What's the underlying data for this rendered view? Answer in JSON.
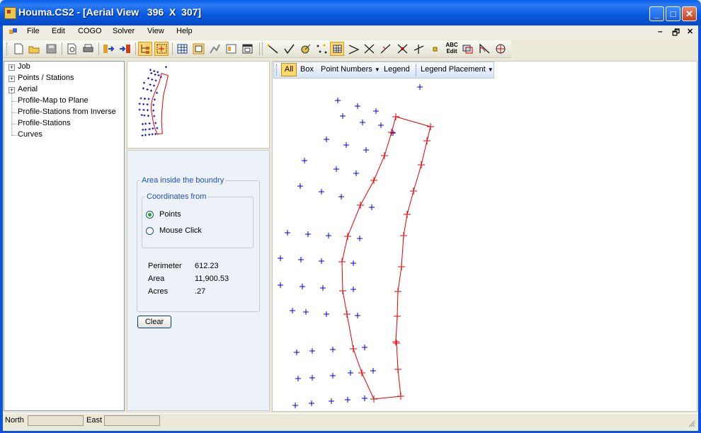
{
  "window": {
    "title": "Houma.CS2 - [Aerial View   396  X  307]",
    "minimize": "_",
    "maximize": "□",
    "close": "✕"
  },
  "menu": [
    "File",
    "Edit",
    "COGO",
    "Solver",
    "View",
    "Help"
  ],
  "mdi_controls": {
    "minimize": "–",
    "restore": "🗗",
    "close": "✕"
  },
  "tree": [
    {
      "label": "Job",
      "expandable": true
    },
    {
      "label": "Points / Stations",
      "expandable": true
    },
    {
      "label": "Aerial",
      "expandable": true
    },
    {
      "label": "Profile-Map to Plane",
      "expandable": false
    },
    {
      "label": "Profile-Stations from Inverse",
      "expandable": false
    },
    {
      "label": "Profile-Stations",
      "expandable": false
    },
    {
      "label": "Curves",
      "expandable": false
    }
  ],
  "area_panel": {
    "group_title": "Area inside the boundry",
    "coords_title": "Coordinates from",
    "radio_points": "Points",
    "radio_mouse": "Mouse Click",
    "selected": "Points",
    "perimeter_label": "Perimeter",
    "perimeter_value": "612.23",
    "area_label": "Area",
    "area_value": "11,900.53",
    "acres_label": "Acres",
    "acres_value": ".27",
    "clear_button": "Clear"
  },
  "map_toolbar": {
    "all": "All",
    "box": "Box",
    "point_numbers": "Point Numbers",
    "legend": "Legend",
    "legend_placement": "Legend Placement"
  },
  "status": {
    "north_label": "North",
    "east_label": "East",
    "north_value": "",
    "east_value": ""
  },
  "colors": {
    "points": "#0000CC",
    "boundary": "#E00000",
    "accent": "#FFD86A"
  },
  "toolbar_icons": [
    "new-file-icon",
    "open-folder-icon",
    "save-icon",
    "print-preview-icon",
    "print-icon",
    "import-icon",
    "export-icon",
    "tree-view-icon",
    "aerial-view-icon",
    "grid-view-icon",
    "map-view-icon",
    "profile-view-icon",
    "report-icon",
    "window-icon",
    "line-icon",
    "check-icon",
    "circle-point-icon",
    "dots-icon",
    "area-icon",
    "angle-icon",
    "intersect-icon",
    "perpendicular-icon",
    "bearing-icon",
    "offset-icon",
    "point-icon",
    "text-edit-icon",
    "layers-icon",
    "arc-icon",
    "quadrant-icon"
  ],
  "abc_edit_label": {
    "top": "ABC",
    "bottom": "Edit"
  }
}
